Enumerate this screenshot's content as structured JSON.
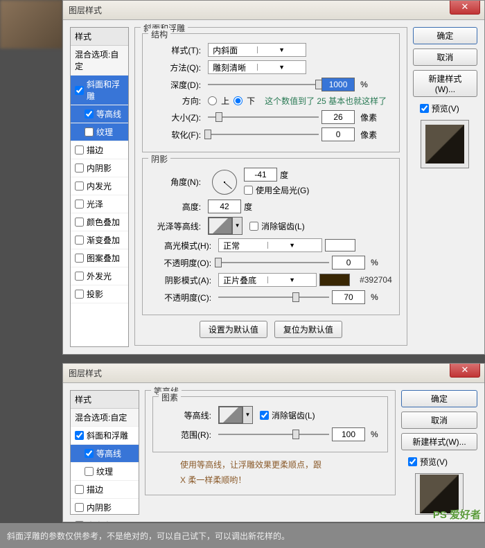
{
  "dialog1": {
    "title": "图层样式",
    "styles": {
      "header": "样式",
      "blend": "混合选项:自定",
      "items": [
        {
          "label": "斜面和浮雕",
          "checked": true,
          "selected": true
        },
        {
          "label": "等高线",
          "checked": true,
          "sub": true,
          "selected": true
        },
        {
          "label": "纹理",
          "checked": false,
          "sub": true,
          "selected": true
        },
        {
          "label": "描边",
          "checked": false
        },
        {
          "label": "内阴影",
          "checked": false
        },
        {
          "label": "内发光",
          "checked": false
        },
        {
          "label": "光泽",
          "checked": false
        },
        {
          "label": "颜色叠加",
          "checked": false
        },
        {
          "label": "渐变叠加",
          "checked": false
        },
        {
          "label": "图案叠加",
          "checked": false
        },
        {
          "label": "外发光",
          "checked": false
        },
        {
          "label": "投影",
          "checked": false
        }
      ]
    },
    "bevel": {
      "legend": "斜面和浮雕",
      "struct": {
        "legend": "结构",
        "style": {
          "label": "样式(T):",
          "value": "内斜面"
        },
        "technique": {
          "label": "方法(Q):",
          "value": "雕刻清晰"
        },
        "depth": {
          "label": "深度(D):",
          "value": "1000",
          "unit": "%",
          "pct": 100
        },
        "direction": {
          "label": "方向:",
          "up": "上",
          "down": "下",
          "note": "这个数值到了 25 基本也就这样了"
        },
        "size": {
          "label": "大小(Z):",
          "value": "26",
          "unit": "像素",
          "pct": 10
        },
        "soften": {
          "label": "软化(F):",
          "value": "0",
          "unit": "像素",
          "pct": 0
        }
      },
      "shading": {
        "legend": "阴影",
        "angle": {
          "label": "角度(N):",
          "value": "-41",
          "unit": "度"
        },
        "global": {
          "label": "使用全局光(G)"
        },
        "altitude": {
          "label": "高度:",
          "value": "42",
          "unit": "度"
        },
        "gloss": {
          "label": "光泽等高线:",
          "anti": "消除锯齿(L)"
        },
        "highmode": {
          "label": "高光模式(H):",
          "value": "正常"
        },
        "highop": {
          "label": "不透明度(O):",
          "value": "0",
          "unit": "%",
          "pct": 0
        },
        "shadmode": {
          "label": "阴影模式(A):",
          "value": "正片叠底",
          "hex": "#392704"
        },
        "shadop": {
          "label": "不透明度(C):",
          "value": "70",
          "unit": "%",
          "pct": 70
        }
      },
      "defaults": {
        "set": "设置为默认值",
        "reset": "复位为默认值"
      }
    },
    "buttons": {
      "ok": "确定",
      "cancel": "取消",
      "newstyle": "新建样式(W)...",
      "preview": "预览(V)"
    }
  },
  "dialog2": {
    "title": "图层样式",
    "styles": {
      "header": "样式",
      "blend": "混合选项:自定",
      "items": [
        {
          "label": "斜面和浮雕",
          "checked": true
        },
        {
          "label": "等高线",
          "checked": true,
          "sub": true,
          "selected": true
        },
        {
          "label": "纹理",
          "checked": false,
          "sub": true
        },
        {
          "label": "描边",
          "checked": false
        },
        {
          "label": "内阴影",
          "checked": false
        },
        {
          "label": "内发光",
          "checked": false
        }
      ]
    },
    "contour": {
      "legend": "等高线",
      "elements": {
        "legend": "图素",
        "contour": {
          "label": "等高线:",
          "anti": "消除锯齿(L)"
        },
        "range": {
          "label": "范围(R):",
          "value": "100",
          "unit": "%",
          "pct": 70
        }
      },
      "tip1": "使用等高线，让浮雕效果更柔顺点，跟",
      "tip2": "X 柔一样柔顺哟！"
    },
    "buttons": {
      "ok": "确定",
      "cancel": "取消",
      "newstyle": "新建样式(W)...",
      "preview": "预览(V)"
    }
  },
  "footer": "斜面浮雕的参数仅供参考，不是绝对的，可以自己试下，可以调出新花样的。",
  "watermark": "PS 爱好者"
}
